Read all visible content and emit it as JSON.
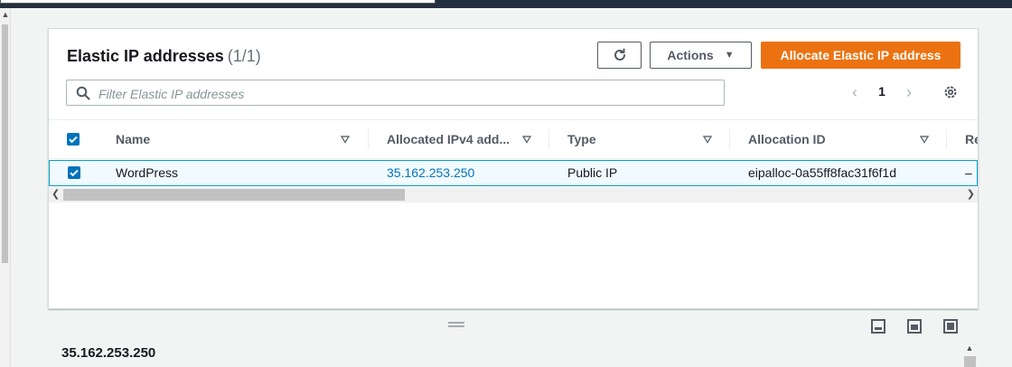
{
  "header": {
    "title": "Elastic IP addresses",
    "count": "(1/1)",
    "actions_label": "Actions",
    "allocate_label": "Allocate Elastic IP address"
  },
  "search": {
    "placeholder": "Filter Elastic IP addresses",
    "value": ""
  },
  "pagination": {
    "current_page": "1"
  },
  "table": {
    "columns": [
      "Name",
      "Allocated IPv4 add...",
      "Type",
      "Allocation ID",
      "Re"
    ],
    "rows": [
      {
        "name": "WordPress",
        "ipv4": "35.162.253.250",
        "type": "Public IP",
        "allocation_id": "eipalloc-0a55ff8fac31f6f1d",
        "extra": "–"
      }
    ]
  },
  "detail": {
    "title": "35.162.253.250"
  },
  "colors": {
    "primary": "#ec7211",
    "link": "#0073bb",
    "selected_row_bg": "#f1faff",
    "selected_row_border": "#00a1c9",
    "topbar": "#232f3e"
  }
}
